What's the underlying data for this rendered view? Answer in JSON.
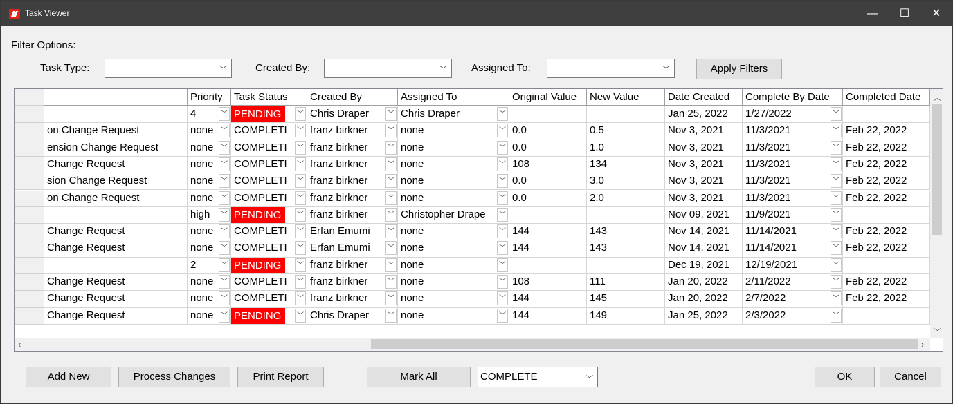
{
  "window": {
    "title": "Task Viewer",
    "min_label": "—",
    "max_label": "☐",
    "close_label": "✕"
  },
  "filter": {
    "heading": "Filter Options:",
    "task_type_label": "Task Type:",
    "created_by_label": "Created By:",
    "assigned_to_label": "Assigned To:",
    "apply_label": "Apply Filters"
  },
  "columns": [
    "Priority",
    "Task Status",
    "Created By",
    "Assigned To",
    "Original Value",
    "New Value",
    "Date Created",
    "Complete By Date",
    "Completed Date"
  ],
  "rows": [
    {
      "task": "",
      "priority": "4",
      "status": "PENDING",
      "created_by": "Chris Draper",
      "assigned_to": "Chris Draper",
      "orig": "",
      "new": "",
      "created": "Jan 25, 2022",
      "complete_by": "1/27/2022",
      "completed": ""
    },
    {
      "task": "on Change Request",
      "priority": "none",
      "status": "COMPLETI",
      "created_by": "franz birkner",
      "assigned_to": "none",
      "orig": "0.0",
      "new": "0.5",
      "created": "Nov 3, 2021",
      "complete_by": "11/3/2021",
      "completed": "Feb 22, 2022"
    },
    {
      "task": "ension Change Request",
      "priority": "none",
      "status": "COMPLETI",
      "created_by": "franz birkner",
      "assigned_to": "none",
      "orig": "0.0",
      "new": "1.0",
      "created": "Nov 3, 2021",
      "complete_by": "11/3/2021",
      "completed": "Feb 22, 2022"
    },
    {
      "task": "Change Request",
      "priority": "none",
      "status": "COMPLETI",
      "created_by": "franz birkner",
      "assigned_to": "none",
      "orig": "108",
      "new": "134",
      "created": "Nov 3, 2021",
      "complete_by": "11/3/2021",
      "completed": "Feb 22, 2022"
    },
    {
      "task": "sion Change Request",
      "priority": "none",
      "status": "COMPLETI",
      "created_by": "franz birkner",
      "assigned_to": "none",
      "orig": "0.0",
      "new": "3.0",
      "created": "Nov 3, 2021",
      "complete_by": "11/3/2021",
      "completed": "Feb 22, 2022"
    },
    {
      "task": "on Change Request",
      "priority": "none",
      "status": "COMPLETI",
      "created_by": "franz birkner",
      "assigned_to": "none",
      "orig": "0.0",
      "new": "2.0",
      "created": "Nov 3, 2021",
      "complete_by": "11/3/2021",
      "completed": "Feb 22, 2022"
    },
    {
      "task": "",
      "priority": "high",
      "status": "PENDING",
      "created_by": "franz birkner",
      "assigned_to": "Christopher Drape",
      "orig": "",
      "new": "",
      "created": "Nov 09, 2021",
      "complete_by": "11/9/2021",
      "completed": ""
    },
    {
      "task": "Change Request",
      "priority": "none",
      "status": "COMPLETI",
      "created_by": "Erfan Emumi",
      "assigned_to": "none",
      "orig": "144",
      "new": "143",
      "created": "Nov 14, 2021",
      "complete_by": "11/14/2021",
      "completed": "Feb 22, 2022"
    },
    {
      "task": "Change Request",
      "priority": "none",
      "status": "COMPLETI",
      "created_by": "Erfan Emumi",
      "assigned_to": "none",
      "orig": "144",
      "new": "143",
      "created": "Nov 14, 2021",
      "complete_by": "11/14/2021",
      "completed": "Feb 22, 2022"
    },
    {
      "task": "",
      "priority": "2",
      "status": "PENDING",
      "created_by": "franz birkner",
      "assigned_to": "none",
      "orig": "",
      "new": "",
      "created": "Dec 19, 2021",
      "complete_by": "12/19/2021",
      "completed": ""
    },
    {
      "task": "Change Request",
      "priority": "none",
      "status": "COMPLETI",
      "created_by": "franz birkner",
      "assigned_to": "none",
      "orig": "108",
      "new": "111",
      "created": "Jan 20, 2022",
      "complete_by": "2/11/2022",
      "completed": "Feb 22, 2022"
    },
    {
      "task": "Change Request",
      "priority": "none",
      "status": "COMPLETI",
      "created_by": "franz birkner",
      "assigned_to": "none",
      "orig": "144",
      "new": "145",
      "created": "Jan 20, 2022",
      "complete_by": "2/7/2022",
      "completed": "Feb 22, 2022"
    },
    {
      "task": "Change Request",
      "priority": "none",
      "status": "PENDING",
      "created_by": "Chris Draper",
      "assigned_to": "none",
      "orig": "144",
      "new": "149",
      "created": "Jan 25, 2022",
      "complete_by": "2/3/2022",
      "completed": ""
    }
  ],
  "buttons": {
    "add_new": "Add New",
    "process": "Process Changes",
    "print": "Print Report",
    "mark_all": "Mark All",
    "ok": "OK",
    "cancel": "Cancel"
  },
  "mark_select": {
    "value": "COMPLETE"
  },
  "colors": {
    "pending": "#ff0000",
    "titlebar": "#3f3f3f"
  }
}
